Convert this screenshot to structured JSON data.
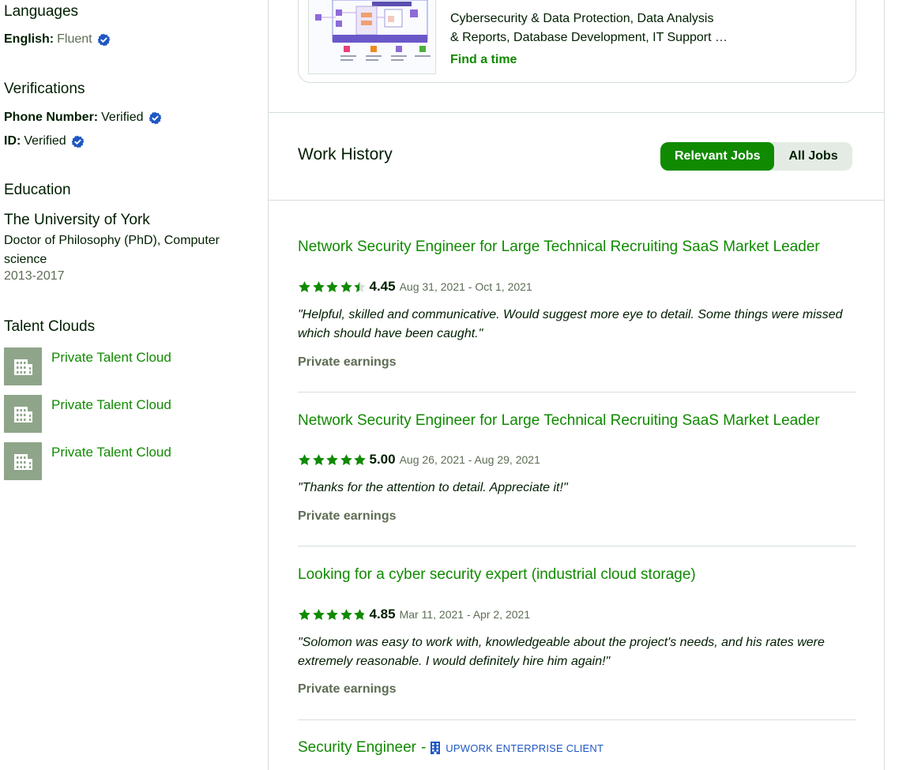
{
  "sidebar": {
    "languages": {
      "title": "Languages",
      "items": [
        {
          "language": "English:",
          "level": "Fluent"
        }
      ]
    },
    "verifications": {
      "title": "Verifications",
      "items": [
        {
          "label": "Phone Number:",
          "value": "Verified"
        },
        {
          "label": "ID:",
          "value": "Verified"
        }
      ]
    },
    "education": {
      "title": "Education",
      "school": "The University of York",
      "degree": "Doctor of Philosophy (PhD), Computer science",
      "years": "2013-2017"
    },
    "talent_clouds": {
      "title": "Talent Clouds",
      "items": [
        {
          "name": "Private Talent Cloud"
        },
        {
          "name": "Private Talent Cloud"
        },
        {
          "name": "Private Talent Cloud"
        }
      ]
    }
  },
  "portfolio": {
    "skills_line1": "Cybersecurity & Data Protection, Data Analysis",
    "skills_line2": "& Reports, Database Development, IT Support …",
    "find_time": "Find a time"
  },
  "work_history": {
    "title": "Work History",
    "tabs": [
      {
        "label": "Relevant Jobs",
        "active": true
      },
      {
        "label": "All Jobs",
        "active": false
      }
    ],
    "jobs": [
      {
        "title": "Network Security Engineer for Large Technical Recruiting SaaS Market Leader",
        "rating": 4.45,
        "score": "4.45",
        "dates": "Aug 31, 2021 - Oct 1, 2021",
        "feedback": "\"Helpful, skilled and communicative. Would suggest more eye to detail. Some things were missed which should have been caught.\"",
        "earnings": "Private earnings"
      },
      {
        "title": "Network Security Engineer for Large Technical Recruiting SaaS Market Leader",
        "rating": 5.0,
        "score": "5.00",
        "dates": "Aug 26, 2021 - Aug 29, 2021",
        "feedback": "\"Thanks for the attention to detail. Appreciate it!\"",
        "earnings": "Private earnings"
      },
      {
        "title": "Looking for a cyber security expert (industrial cloud storage)",
        "rating": 4.85,
        "score": "4.85",
        "dates": "Mar 11, 2021 - Apr 2, 2021",
        "feedback": "\"Solomon was easy to work with, knowledgeable about the project's needs, and his rates were extremely reasonable. I would definitely hire him again!\"",
        "earnings": "Private earnings"
      },
      {
        "title": "Security Engineer",
        "separator": "-",
        "client_tag": "UPWORK ENTERPRISE CLIENT"
      }
    ]
  },
  "colors": {
    "brand_green": "#108a00",
    "verified_blue": "#1f57c3",
    "muted_text": "#5e6d55",
    "divider": "#d5e0d5"
  },
  "icons": {
    "verified": "verified-badge-icon",
    "building": "building-icon",
    "star": "star-icon"
  }
}
